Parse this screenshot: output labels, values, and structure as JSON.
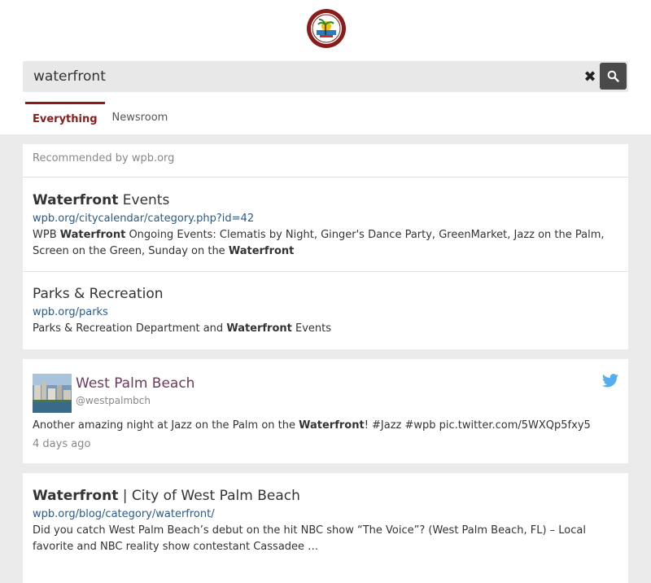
{
  "search": {
    "value": "waterfront"
  },
  "tabs": [
    {
      "label": "Everything"
    },
    {
      "label": "Newsroom"
    }
  ],
  "recommended": {
    "heading": "Recommended by wpb.org",
    "results": [
      {
        "title_bold": "Waterfront",
        "title_rest": " Events",
        "url": "wpb.org/citycalendar/category.php?id=42",
        "desc_parts": [
          "WPB ",
          "Waterfront",
          " Ongoing Events: Clematis by Night, Ginger's Dance Party, GreenMarket, Jazz on the Palm, Screen on the Green, Sunday on the ",
          "Waterfront",
          ""
        ]
      },
      {
        "title_bold": "",
        "title_rest": "Parks & Recreation",
        "url": "wpb.org/parks",
        "desc_parts": [
          "Parks & Recreation Department and ",
          "Waterfront",
          " Events",
          "",
          ""
        ]
      }
    ]
  },
  "tweet": {
    "name": "West Palm Beach",
    "handle": "@westpalmbch",
    "text_parts": [
      "Another amazing night at Jazz on the Palm on the ",
      "Waterfront",
      "! #Jazz #wpb pic.twitter.com/5WXQp5fxy5"
    ],
    "time": "4 days ago",
    "bird_color": "#55acee"
  },
  "web_result": {
    "title_bold": "Waterfront",
    "title_rest": " | City of West Palm Beach",
    "url": "wpb.org/blog/category/waterfront/",
    "desc": "Did you catch West Palm Beach’s debut on the hit NBC show “The Voice”? (West Palm Beach, FL) – Local favorite and NBC reality show contestant Cassadee …"
  },
  "colors": {
    "accent": "#8b1c1c",
    "link": "#2a5a8a",
    "tweet_name": "#6b3a5a"
  }
}
